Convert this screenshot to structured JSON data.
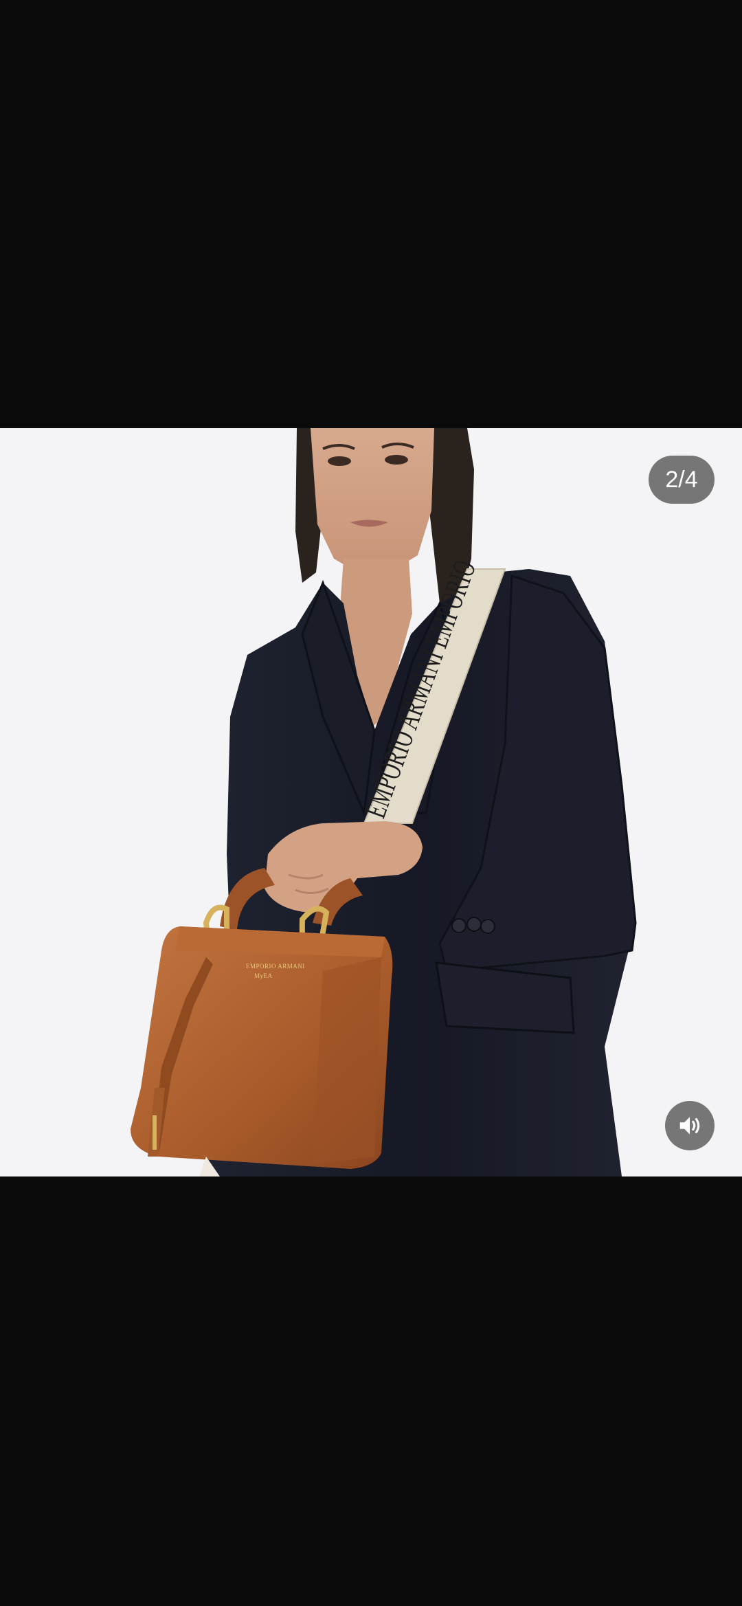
{
  "viewer": {
    "counter": "2/4",
    "sound_icon": "speaker-volume-icon"
  },
  "image": {
    "strap_text": "EMPORIO ARMANI EMPORIO",
    "bag_logo_text": "EMPORIO ARMANI",
    "bag_logo_sub": "MyEA"
  },
  "colors": {
    "letterbox": "#0a0a0a",
    "photo_background": "#f4f4f6",
    "overlay": "#646464",
    "bag": "#b0642f",
    "jacket": "#1b1e2a",
    "strap": "#e3dccb"
  }
}
